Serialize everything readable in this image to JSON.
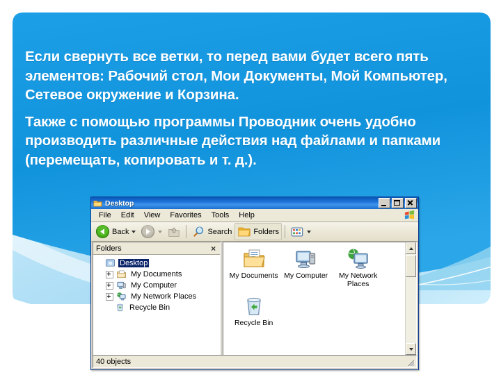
{
  "slide": {
    "paragraphs": [
      "Если свернуть все ветки, то перед вами будет всего пять элементов: Рабочий стол, Мои Документы, Мой Компьютер, Сетевое окружение и Корзина.",
      "Также с помощью программы Проводник очень удобно производить различные действия над файлами и папками (перемещать, копировать и т. д.)."
    ],
    "colors": {
      "background": "#ffffff",
      "panel_blue": "#1395dc",
      "panel_blue_dark": "#0d86d0",
      "swoosh_light": "#a8dcf5",
      "text": "#ffffff"
    }
  },
  "window": {
    "title": "Desktop",
    "title_icon": "folder-icon",
    "controls": {
      "minimize": "minimize-icon",
      "maximize": "maximize-icon",
      "close": "close-icon"
    },
    "menu": [
      "File",
      "Edit",
      "View",
      "Favorites",
      "Tools",
      "Help"
    ],
    "brand_icon": "windows-flag-icon",
    "toolbar": [
      {
        "label": "Back",
        "icon": "back-arrow-icon",
        "dropdown": true
      },
      {
        "label": "",
        "icon": "forward-arrow-icon",
        "dropdown": true
      },
      {
        "label": "",
        "icon": "up-folder-icon",
        "dropdown": false
      },
      {
        "label": "Search",
        "icon": "magnifier-icon",
        "dropdown": false
      },
      {
        "label": "Folders",
        "icon": "folder-icon",
        "dropdown": false
      },
      {
        "label": "",
        "icon": "views-grid-icon",
        "dropdown": true
      }
    ],
    "folders_pane": {
      "header": "Folders",
      "close": "×",
      "tree": [
        {
          "label": "Desktop",
          "icon": "desktop-icon",
          "expander": false,
          "selected": true,
          "indent": 0
        },
        {
          "label": "My Documents",
          "icon": "my-documents-icon",
          "expander": true,
          "selected": false,
          "indent": 1
        },
        {
          "label": "My Computer",
          "icon": "my-computer-icon",
          "expander": true,
          "selected": false,
          "indent": 1
        },
        {
          "label": "My Network Places",
          "icon": "my-network-places-icon",
          "expander": true,
          "selected": false,
          "indent": 1
        },
        {
          "label": "Recycle Bin",
          "icon": "recycle-bin-icon",
          "expander": false,
          "selected": false,
          "indent": 1
        }
      ]
    },
    "content_items": [
      {
        "label": "My Documents",
        "icon": "my-documents-icon"
      },
      {
        "label": "My Computer",
        "icon": "my-computer-icon"
      },
      {
        "label": "My Network Places",
        "icon": "my-network-places-icon"
      },
      {
        "label": "Recycle Bin",
        "icon": "recycle-bin-icon"
      }
    ],
    "status": "40 objects"
  }
}
